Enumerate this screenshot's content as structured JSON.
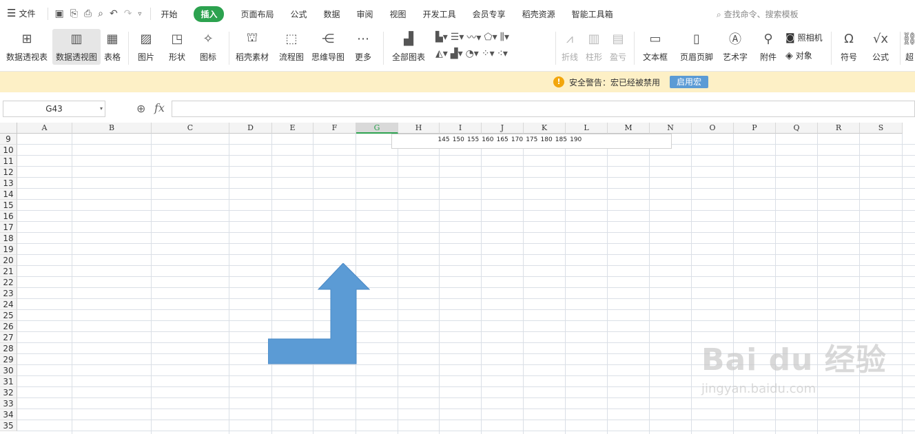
{
  "menubar": {
    "file_label": "文件",
    "tabs": [
      "开始",
      "插入",
      "页面布局",
      "公式",
      "数据",
      "审阅",
      "视图",
      "开发工具",
      "会员专享",
      "稻壳资源",
      "智能工具箱"
    ],
    "active_tab": "插入",
    "search_label": "查找命令、搜索模板"
  },
  "ribbon": {
    "pivot_table": "数据透视表",
    "pivot_chart": "数据透视图",
    "table": "表格",
    "picture": "图片",
    "shape": "形状",
    "icon": "图标",
    "docer_material": "稻壳素材",
    "flowchart": "流程图",
    "mindmap": "思维导图",
    "more": "更多",
    "all_charts": "全部图表",
    "sparkline_line": "折线",
    "sparkline_column": "柱形",
    "sparkline_winloss": "盈亏",
    "textbox": "文本框",
    "header_footer": "页眉页脚",
    "wordart": "艺术字",
    "attachment": "附件",
    "camera": "照相机",
    "object": "对象",
    "symbol": "符号",
    "formula": "公式",
    "hyperlink": "超"
  },
  "warning": {
    "text": "安全警告：宏已经被禁用",
    "button": "启用宏"
  },
  "formula_bar": {
    "name_box": "G43",
    "fx": "fx",
    "value": ""
  },
  "sheet": {
    "columns": [
      "A",
      "B",
      "C",
      "D",
      "E",
      "F",
      "G",
      "H",
      "I",
      "J",
      "K",
      "L",
      "M",
      "N",
      "O",
      "P",
      "Q",
      "R",
      "S"
    ],
    "selected_column": "G",
    "rows": [
      "9",
      "10",
      "11",
      "12",
      "13",
      "14",
      "15",
      "16",
      "17",
      "18",
      "19",
      "20",
      "21",
      "22",
      "23",
      "24",
      "25",
      "26",
      "27",
      "28",
      "29",
      "30",
      "31",
      "32",
      "33",
      "34",
      "35"
    ],
    "axis_labels": [
      "145",
      "150",
      "155",
      "160",
      "165",
      "170",
      "175",
      "180",
      "185",
      "190"
    ]
  },
  "shape": {
    "type": "bent-up-arrow",
    "fill": "#5b9bd5"
  },
  "watermark": {
    "brand": "Bai du 经验",
    "url": "jingyan.baidu.com"
  }
}
